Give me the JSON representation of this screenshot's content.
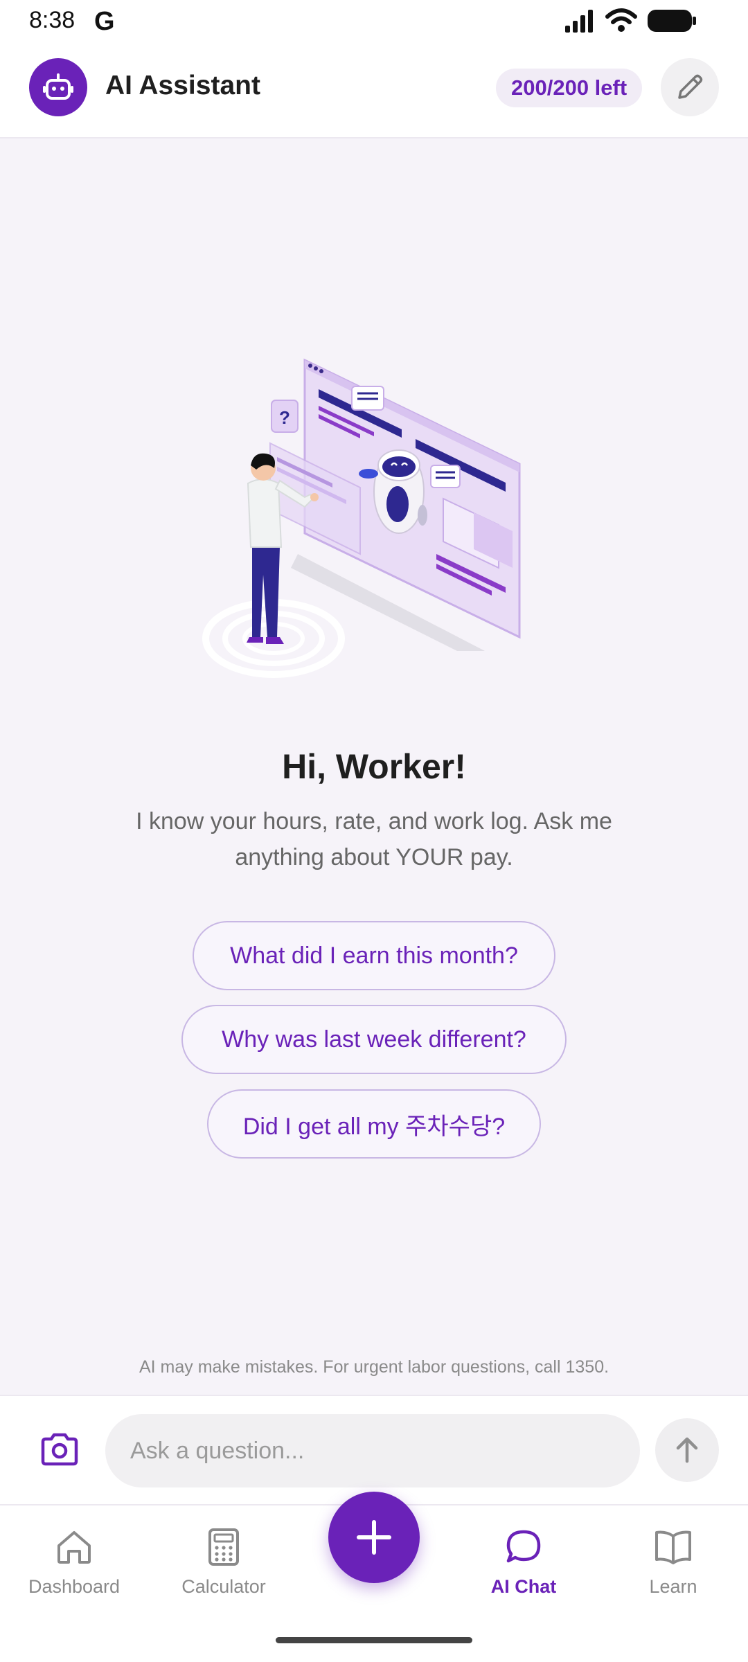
{
  "status_bar": {
    "time": "8:38",
    "g_logo": "G"
  },
  "header": {
    "title": "AI Assistant",
    "quota": "200/200 left",
    "icons": [
      "robot-icon",
      "pencil-icon"
    ]
  },
  "hero": {
    "title": "Hi, Worker!",
    "subtitle": "I know your hours, rate, and work log. Ask me anything about YOUR pay."
  },
  "suggestions": [
    "What did I earn this month?",
    "Why was last week different?",
    "Did I get all my 주차수당?"
  ],
  "disclaimer": "AI may make mistakes. For urgent labor questions, call 1350.",
  "input": {
    "placeholder": "Ask a question..."
  },
  "nav": {
    "items": [
      {
        "label": "Dashboard",
        "icon": "home-icon"
      },
      {
        "label": "Calculator",
        "icon": "calculator-icon"
      },
      {
        "label": "AI Chat",
        "icon": "chat-bubble-icon",
        "active": true
      },
      {
        "label": "Learn",
        "icon": "book-icon"
      }
    ],
    "fab_icon": "plus-icon"
  },
  "colors": {
    "accent": "#6a22b8",
    "background": "#f6f3f9"
  }
}
